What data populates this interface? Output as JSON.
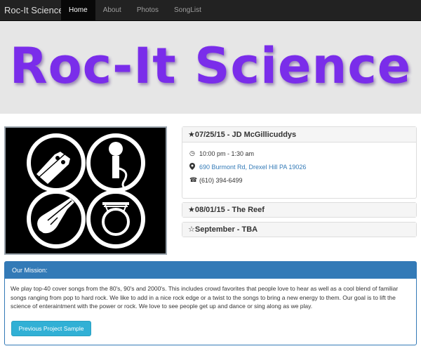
{
  "navbar": {
    "brand": "Roc-It Science",
    "items": [
      {
        "label": "Home",
        "active": true
      },
      {
        "label": "About",
        "active": false
      },
      {
        "label": "Photos",
        "active": false
      },
      {
        "label": "SongList",
        "active": false
      }
    ]
  },
  "hero": {
    "title": "Roc-It Science",
    "title_color": "#7a2dea"
  },
  "events": [
    {
      "star": "★",
      "heading": "07/25/15 - JD McGillicuddys",
      "time": "10:00 pm - 1:30 am",
      "address": "690 Burmont Rd, Drexel Hill PA 19026",
      "phone": "(610) 394-6499"
    },
    {
      "star": "★",
      "heading": "08/01/15 - The Reef"
    },
    {
      "star": "☆",
      "heading": "September - TBA"
    }
  ],
  "mission": {
    "title": "Our Mission:",
    "body": "We play top-40 cover songs from the 80's, 90's and 2000's. This includes crowd favorites that people love to hear as well as a cool blend of familiar songs ranging from pop to hard rock. We like to add in a nice rock edge or a twist to the songs to bring a new energy to them. Our goal is to lift the science of enteraintment with the power or rock. We love to see people get up and dance or sing along as we play.",
    "button_label": "Previous Project Sample",
    "accent": "#337ab7",
    "button_color": "#31b0d5"
  },
  "icons": {
    "clock": "clock-icon",
    "map_marker": "map-marker-icon",
    "phone": "phone-icon"
  }
}
